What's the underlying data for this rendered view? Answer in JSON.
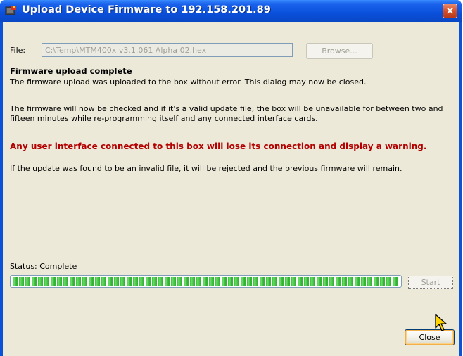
{
  "window": {
    "title": "Upload Device Firmware to 192.158.201.89",
    "app_icon": "firmware-chip-icon",
    "close_glyph": "×"
  },
  "file": {
    "label": "File:",
    "value": "C:\\Temp\\MTM400x v3.1.061 Alpha 02.hex",
    "browse_label": "Browse..."
  },
  "messages": {
    "heading": "Firmware upload complete",
    "line1": "The firmware upload was uploaded to the box without error. This dialog may now be closed.",
    "line2": "The firmware will now be checked and if it's a valid update file, the box will be unavailable for between two and fifteen minutes while re-programming itself and any connected interface cards.",
    "warning": "Any user interface connected to this box will lose its connection and display a warning.",
    "line3": "If the update was found to be an invalid file, it will be rejected and the previous firmware will remain."
  },
  "status": {
    "label": "Status: Complete",
    "progress": 1.0
  },
  "buttons": {
    "start_label": "Start",
    "close_label": "Close"
  },
  "colors": {
    "warning": "#b40000",
    "progress": "#35c035",
    "titlebar": "#0a50dc"
  }
}
